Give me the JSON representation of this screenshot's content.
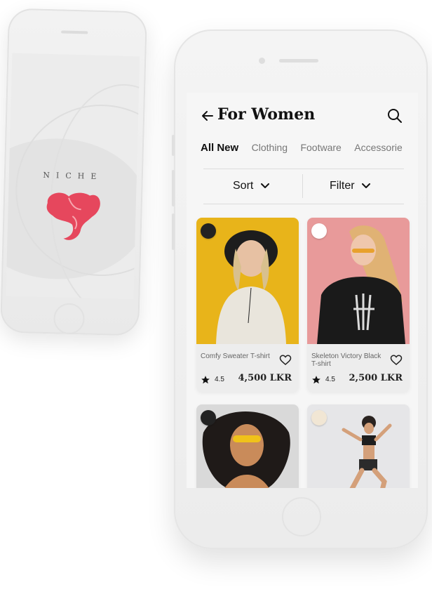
{
  "splash": {
    "brand": "NICHE",
    "logo_icon": "elephant-logo-icon",
    "logo_color": "#e6475d"
  },
  "header": {
    "title": "For Women",
    "back_icon": "arrow-left-icon",
    "search_icon": "search-icon"
  },
  "tabs": [
    {
      "label": "All New"
    },
    {
      "label": "Clothing"
    },
    {
      "label": "Footware"
    },
    {
      "label": "Accessorie"
    }
  ],
  "toolbar": {
    "sort_label": "Sort",
    "filter_label": "Filter"
  },
  "products": [
    {
      "name": "Comfy Sweater T-shirt",
      "rating": "4.5",
      "price": "4,500 LKR"
    },
    {
      "name": "Skeleton Victory Black T-shirt",
      "rating": "4.5",
      "price": "2,500 LKR"
    }
  ],
  "colors": {
    "text_primary": "#111111",
    "text_secondary": "#777777",
    "screen_bg": "#f6f6f6",
    "card_1_bg": "#e8b41a",
    "card_2_bg": "#e89a9a"
  }
}
